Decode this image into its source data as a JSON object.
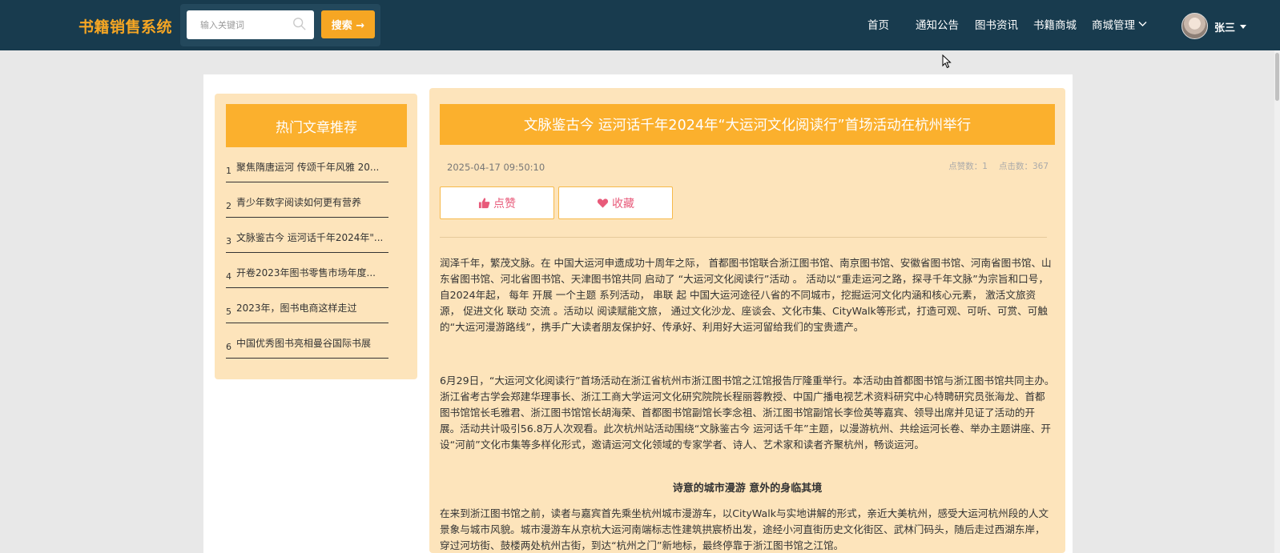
{
  "header": {
    "logo": "书籍销售系统",
    "search_placeholder": "输入关键词",
    "search_button": "搜索 →",
    "nav": [
      "首页",
      "通知公告",
      "图书资讯",
      "书籍商城",
      "商城管理"
    ],
    "username": "张三"
  },
  "sidebar": {
    "title": "热门文章推荐",
    "items": [
      {
        "num": "1",
        "text": "聚焦隋唐运河 传颂千年风雅 20..."
      },
      {
        "num": "2",
        "text": "青少年数字阅读如何更有营养"
      },
      {
        "num": "3",
        "text": "文脉鉴古今 运河话千年2024年\"..."
      },
      {
        "num": "4",
        "text": "开卷2023年图书零售市场年度..."
      },
      {
        "num": "5",
        "text": "2023年，图书电商这样走过"
      },
      {
        "num": "6",
        "text": "中国优秀图书亮相曼谷国际书展"
      }
    ]
  },
  "article": {
    "title": "文脉鉴古今 运河话千年2024年“大运河文化阅读行”首场活动在杭州举行",
    "date": "2025-04-17 09:50:10",
    "likes": "点赞数：1",
    "clicks": "点击数：367",
    "like_button": "点赞",
    "fav_button": "收藏",
    "para1": "润泽千年，繁茂文脉。在 中国大运河申遗成功十周年之际， 首都图书馆联合浙江图书馆、南京图书馆、安徽省图书馆、河南省图书馆、山东省图书馆、河北省图书馆、天津图书馆共同 启动了 “大运河文化阅读行”活动 。 活动以“重走运河之路，探寻千年文脉”为宗旨和口号，自2024年起， 每年 开展 一个主题 系列活动， 串联 起 中国大运河途径八省的不同城市，挖掘运河文化内涵和核心元素， 激活文旅资源， 促进文化 联动 交流 。活动以 阅读赋能文旅， 通过文化沙龙、座谈会、文化市集、CityWalk等形式，打造可观、可听、可赏、可触的“大运河漫游路线”，携手广大读者朋友保护好、传承好、利用好大运河留给我们的宝贵遗产。",
    "para2": "6月29日，“大运河文化阅读行”首场活动在浙江省杭州市浙江图书馆之江馆报告厅隆重举行。本活动由首都图书馆与浙江图书馆共同主办。浙江省考古学会郑建华理事长、浙江工商大学运河文化研究院院长程丽蓉教授、中国广播电视艺术资料研究中心特聘研究员张海龙、首都图书馆馆长毛雅君、浙江图书馆馆长胡海荣、首都图书馆副馆长李念祖、浙江图书馆副馆长李俭英等嘉宾、领导出席并见证了活动的开展。活动共计吸引56.8万人次观看。此次杭州站活动围绕“文脉鉴古今 运河话千年”主题，以漫游杭州、共绘运河长卷、举办主题讲座、开设“河前”文化市集等多样化形式，邀请运河文化领域的专家学者、诗人、艺术家和读者齐聚杭州，畅谈运河。",
    "subheading": "诗意的城市漫游 意外的身临其境",
    "para3": "在来到浙江图书馆之前，读者与嘉宾首先乘坐杭州城市漫游车，以CityWalk与实地讲解的形式，亲近大美杭州，感受大运河杭州段的人文景象与城市风貌。城市漫游车从京杭大运河南端标志性建筑拱宸桥出发，途经小河直街历史文化街区、武林门码头，随后走过西湖东岸，穿过河坊街、鼓楼两处杭州古街，到达“杭州之门”新地标，最终停靠于浙江图书馆之江馆。"
  },
  "colors": {
    "topbar": "#183b4e",
    "accent": "#fbb02d",
    "panel": "#fde4bb",
    "action_text": "#e85a7a"
  }
}
